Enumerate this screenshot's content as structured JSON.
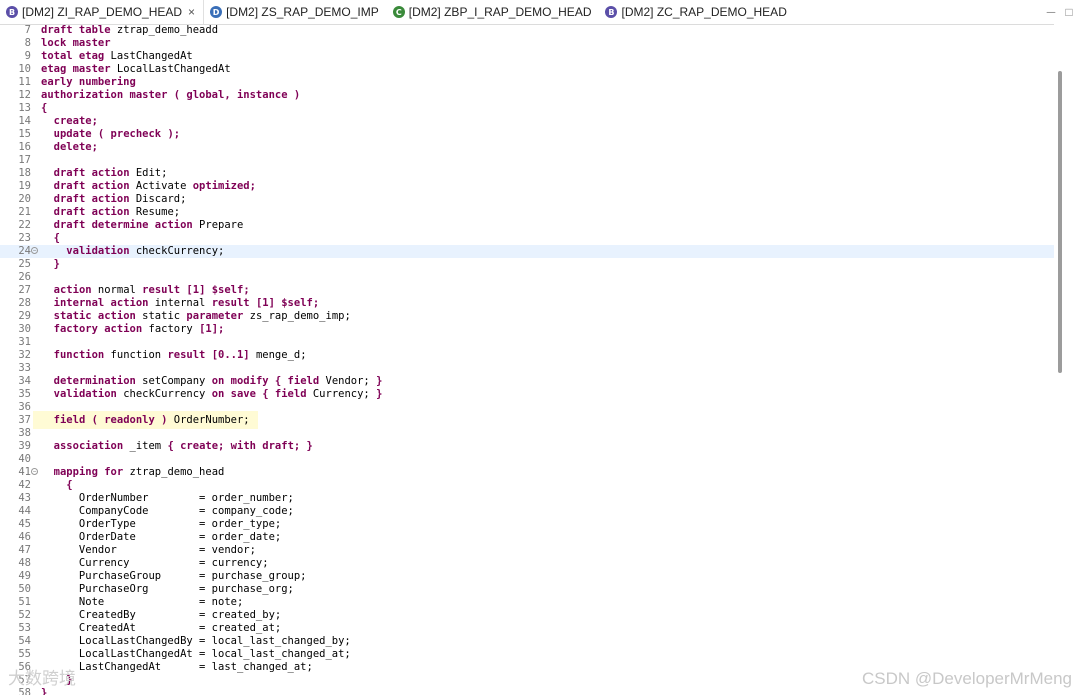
{
  "tabs": [
    {
      "label": "[DM2] ZI_RAP_DEMO_HEAD",
      "icon": "behavior-definition-icon",
      "icon_letter": "B",
      "icon_color": "#5b4fa8",
      "active": true,
      "closable": true
    },
    {
      "label": "[DM2] ZS_RAP_DEMO_IMP",
      "icon": "data-definition-icon",
      "icon_letter": "D",
      "icon_color": "#3a6fb8",
      "active": false,
      "closable": false
    },
    {
      "label": "[DM2] ZBP_I_RAP_DEMO_HEAD",
      "icon": "class-icon",
      "icon_letter": "C",
      "icon_color": "#3a8a3a",
      "active": false,
      "closable": false
    },
    {
      "label": "[DM2] ZC_RAP_DEMO_HEAD",
      "icon": "behavior-definition-icon",
      "icon_letter": "B",
      "icon_color": "#5b4fa8",
      "active": false,
      "closable": false
    }
  ],
  "editor": {
    "current_line": "24",
    "lines": [
      {
        "num": "7",
        "tokens": [
          [
            "k",
            "draft table"
          ],
          [
            "t",
            " ztrap_demo_headd"
          ]
        ]
      },
      {
        "num": "8",
        "tokens": [
          [
            "k",
            "lock master"
          ]
        ]
      },
      {
        "num": "9",
        "tokens": [
          [
            "k",
            "total etag"
          ],
          [
            "t",
            " LastChangedAt"
          ]
        ]
      },
      {
        "num": "10",
        "tokens": [
          [
            "k",
            "etag master"
          ],
          [
            "t",
            " LocalLastChangedAt"
          ]
        ]
      },
      {
        "num": "11",
        "tokens": [
          [
            "k",
            "early numbering"
          ]
        ]
      },
      {
        "num": "12",
        "tokens": [
          [
            "k",
            "authorization master ( global, instance )"
          ]
        ]
      },
      {
        "num": "13",
        "tokens": [
          [
            "k",
            "{"
          ]
        ]
      },
      {
        "num": "14",
        "tokens": [
          [
            "t",
            "  "
          ],
          [
            "k",
            "create;"
          ]
        ]
      },
      {
        "num": "15",
        "tokens": [
          [
            "t",
            "  "
          ],
          [
            "k",
            "update ( precheck );"
          ]
        ]
      },
      {
        "num": "16",
        "tokens": [
          [
            "t",
            "  "
          ],
          [
            "k",
            "delete;"
          ]
        ]
      },
      {
        "num": "17",
        "tokens": []
      },
      {
        "num": "18",
        "tokens": [
          [
            "t",
            "  "
          ],
          [
            "k",
            "draft action"
          ],
          [
            "t",
            " Edit;"
          ]
        ]
      },
      {
        "num": "19",
        "tokens": [
          [
            "t",
            "  "
          ],
          [
            "k",
            "draft action"
          ],
          [
            "t",
            " Activate "
          ],
          [
            "k",
            "optimized;"
          ]
        ]
      },
      {
        "num": "20",
        "tokens": [
          [
            "t",
            "  "
          ],
          [
            "k",
            "draft action"
          ],
          [
            "t",
            " Discard;"
          ]
        ]
      },
      {
        "num": "21",
        "tokens": [
          [
            "t",
            "  "
          ],
          [
            "k",
            "draft action"
          ],
          [
            "t",
            " Resume;"
          ]
        ]
      },
      {
        "num": "22",
        "tokens": [
          [
            "t",
            "  "
          ],
          [
            "k",
            "draft determine action"
          ],
          [
            "t",
            " Prepare"
          ]
        ]
      },
      {
        "num": "23",
        "tokens": [
          [
            "t",
            "  "
          ],
          [
            "k",
            "{"
          ]
        ]
      },
      {
        "num": "24",
        "fold": true,
        "tokens": [
          [
            "t",
            "    "
          ],
          [
            "k",
            "validation"
          ],
          [
            "t",
            " checkCurrency;"
          ]
        ]
      },
      {
        "num": "25",
        "tokens": [
          [
            "t",
            "  "
          ],
          [
            "k",
            "}"
          ]
        ]
      },
      {
        "num": "26",
        "tokens": []
      },
      {
        "num": "27",
        "tokens": [
          [
            "t",
            "  "
          ],
          [
            "k",
            "action"
          ],
          [
            "t",
            " normal "
          ],
          [
            "k",
            "result [1] $self;"
          ]
        ]
      },
      {
        "num": "28",
        "tokens": [
          [
            "t",
            "  "
          ],
          [
            "k",
            "internal action"
          ],
          [
            "t",
            " internal "
          ],
          [
            "k",
            "result [1] $self;"
          ]
        ]
      },
      {
        "num": "29",
        "tokens": [
          [
            "t",
            "  "
          ],
          [
            "k",
            "static action"
          ],
          [
            "t",
            " static "
          ],
          [
            "k",
            "parameter"
          ],
          [
            "t",
            " zs_rap_demo_imp;"
          ]
        ]
      },
      {
        "num": "30",
        "tokens": [
          [
            "t",
            "  "
          ],
          [
            "k",
            "factory action"
          ],
          [
            "t",
            " factory "
          ],
          [
            "k",
            "[1];"
          ]
        ]
      },
      {
        "num": "31",
        "tokens": []
      },
      {
        "num": "32",
        "tokens": [
          [
            "t",
            "  "
          ],
          [
            "k",
            "function"
          ],
          [
            "t",
            " function "
          ],
          [
            "k",
            "result [0..1]"
          ],
          [
            "t",
            " menge_d;"
          ]
        ]
      },
      {
        "num": "33",
        "tokens": []
      },
      {
        "num": "34",
        "tokens": [
          [
            "t",
            "  "
          ],
          [
            "k",
            "determination"
          ],
          [
            "t",
            " setCompany "
          ],
          [
            "k",
            "on modify { field"
          ],
          [
            "t",
            " Vendor; "
          ],
          [
            "k",
            "}"
          ]
        ]
      },
      {
        "num": "35",
        "tokens": [
          [
            "t",
            "  "
          ],
          [
            "k",
            "validation"
          ],
          [
            "t",
            " checkCurrency "
          ],
          [
            "k",
            "on save { field"
          ],
          [
            "t",
            " Currency; "
          ],
          [
            "k",
            "}"
          ]
        ]
      },
      {
        "num": "36",
        "tokens": []
      },
      {
        "num": "37",
        "highlight": true,
        "tokens": [
          [
            "t",
            "  "
          ],
          [
            "k",
            "field ( readonly )"
          ],
          [
            "t",
            " OrderNumber;"
          ]
        ]
      },
      {
        "num": "38",
        "tokens": []
      },
      {
        "num": "39",
        "tokens": [
          [
            "t",
            "  "
          ],
          [
            "k",
            "association"
          ],
          [
            "t",
            " _item "
          ],
          [
            "k",
            "{ create; with draft; }"
          ]
        ]
      },
      {
        "num": "40",
        "tokens": []
      },
      {
        "num": "41",
        "fold": true,
        "tokens": [
          [
            "t",
            "  "
          ],
          [
            "k",
            "mapping for"
          ],
          [
            "t",
            " ztrap_demo_head"
          ]
        ]
      },
      {
        "num": "42",
        "tokens": [
          [
            "t",
            "    "
          ],
          [
            "k",
            "{"
          ]
        ]
      },
      {
        "num": "43",
        "tokens": [
          [
            "t",
            "      OrderNumber        = order_number;"
          ]
        ]
      },
      {
        "num": "44",
        "tokens": [
          [
            "t",
            "      CompanyCode        = company_code;"
          ]
        ]
      },
      {
        "num": "45",
        "tokens": [
          [
            "t",
            "      OrderType          = order_type;"
          ]
        ]
      },
      {
        "num": "46",
        "tokens": [
          [
            "t",
            "      OrderDate          = order_date;"
          ]
        ]
      },
      {
        "num": "47",
        "tokens": [
          [
            "t",
            "      Vendor             = vendor;"
          ]
        ]
      },
      {
        "num": "48",
        "tokens": [
          [
            "t",
            "      Currency           = currency;"
          ]
        ]
      },
      {
        "num": "49",
        "tokens": [
          [
            "t",
            "      PurchaseGroup      = purchase_group;"
          ]
        ]
      },
      {
        "num": "50",
        "tokens": [
          [
            "t",
            "      PurchaseOrg        = purchase_org;"
          ]
        ]
      },
      {
        "num": "51",
        "tokens": [
          [
            "t",
            "      Note               = note;"
          ]
        ]
      },
      {
        "num": "52",
        "tokens": [
          [
            "t",
            "      CreatedBy          = created_by;"
          ]
        ]
      },
      {
        "num": "53",
        "tokens": [
          [
            "t",
            "      CreatedAt          = created_at;"
          ]
        ]
      },
      {
        "num": "54",
        "tokens": [
          [
            "t",
            "      LocalLastChangedBy = local_last_changed_by;"
          ]
        ]
      },
      {
        "num": "55",
        "tokens": [
          [
            "t",
            "      LocalLastChangedAt = local_last_changed_at;"
          ]
        ]
      },
      {
        "num": "56",
        "tokens": [
          [
            "t",
            "      LastChangedAt      = last_changed_at;"
          ]
        ]
      },
      {
        "num": "57",
        "tokens": [
          [
            "t",
            "    "
          ],
          [
            "k",
            "}"
          ]
        ]
      },
      {
        "num": "58",
        "tokens": [
          [
            "k",
            "}"
          ]
        ]
      }
    ]
  },
  "scrollbar": {
    "thumb_start_fraction": 0.07,
    "thumb_size_fraction": 0.45
  },
  "watermark": {
    "right": "CSDN @DeveloperMrMeng",
    "left": "大数跨境"
  },
  "window_buttons": {
    "minimize": "─",
    "maximize": "□"
  },
  "colors": {
    "keyword": "#7f0055",
    "line_number": "#787878",
    "current_line_bg": "#e8f2fe",
    "occurrence_highlight_bg": "#fffbd5"
  }
}
